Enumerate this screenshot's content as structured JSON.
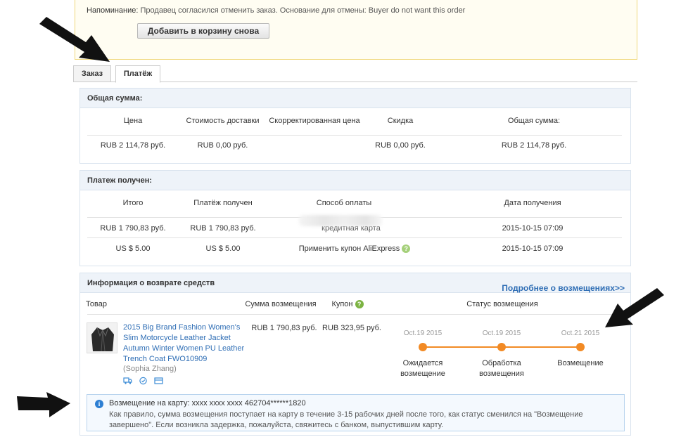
{
  "notice": {
    "label": "Напоминание:",
    "text": "Продавец согласился отменить заказ. Основание для отмены: Buyer do not want this order",
    "readd_button": "Добавить в корзину снова"
  },
  "tabs": [
    {
      "label": "Заказ",
      "active": false
    },
    {
      "label": "Платёж",
      "active": true
    }
  ],
  "total": {
    "title": "Общая сумма:",
    "headers": [
      "Цена",
      "Стоимость доставки",
      "Скорректированная цена",
      "Скидка",
      "Общая сумма:"
    ],
    "values": [
      "RUB 2 114,78 руб.",
      "RUB 0,00 руб.",
      "",
      "RUB 0,00 руб.",
      "RUB 2 114,78 руб."
    ]
  },
  "payment": {
    "title": "Платеж получен:",
    "headers": [
      "Итого",
      "Платёж получен",
      "Способ оплаты",
      "Дата получения"
    ],
    "rows": [
      [
        "RUB 1 790,83 руб.",
        "RUB 1 790,83 руб.",
        "кредитная карта",
        "2015-10-15 07:09"
      ],
      [
        "US $ 5.00",
        "US $ 5.00",
        "Применить купон AliExpress",
        "2015-10-15 07:09"
      ]
    ]
  },
  "refund": {
    "title": "Информация о возврате средств",
    "details_link": "Подробнее о возмещениях>>",
    "headers": {
      "product": "Товар",
      "amount": "Сумма возмещения",
      "coupon": "Купон",
      "status": "Статус возмещения"
    },
    "product": {
      "name": "2015 Big Brand Fashion Women's Slim Motorcycle Leather Jacket Autumn Winter Women PU Leather Trench Coat FWO10909",
      "seller": "(Sophia Zhang)",
      "amount": "RUB 1 790,83 руб.",
      "coupon": "RUB 323,95 руб."
    },
    "timeline": [
      {
        "date": "Oct.19 2015",
        "label": "Ожидается возмещение"
      },
      {
        "date": "Oct.19 2015",
        "label": "Обработка возмещения"
      },
      {
        "date": "Oct.21 2015",
        "label": "Возмещение"
      }
    ],
    "info": {
      "title": "Возмещение на карту: xxxx xxxx xxxx 462704******1820",
      "text": "Как правило, сумма возмещения поступает на карту в течение 3-15 рабочих дней после того, как статус сменился на \"Возмещение завершено\". Если возникла задержка, пожалуйста, свяжитесь с банком, выпустившим карту."
    }
  },
  "colors": {
    "accent_orange": "#f28a24",
    "link_blue": "#2f6eb5",
    "panel_header": "#eef3f9",
    "info_icon": "#2d7fd3",
    "coupon_icon": "#7cb342"
  }
}
